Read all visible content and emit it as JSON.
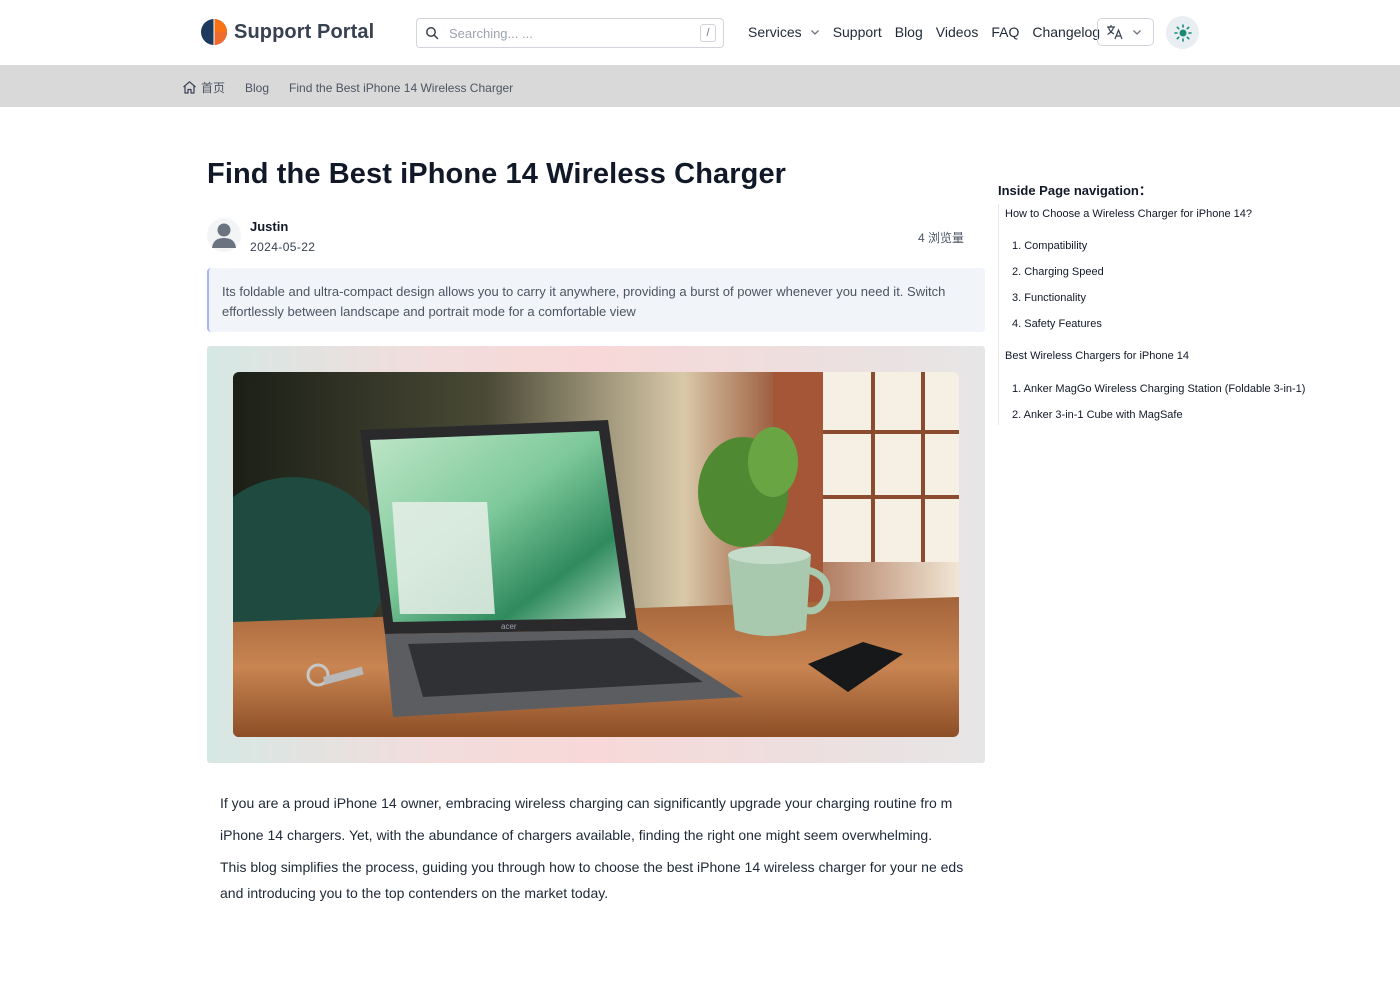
{
  "header": {
    "brand": "Support Portal",
    "search_placeholder": "Searching... ...",
    "search_shortcut": "/",
    "nav": [
      "Services",
      "Support",
      "Blog",
      "Videos",
      "FAQ",
      "Changelog"
    ]
  },
  "breadcrumb": [
    "首页",
    "Blog",
    "Find the Best iPhone 14 Wireless Charger"
  ],
  "article": {
    "title": "Find the Best iPhone 14 Wireless Charger",
    "author": "Justin",
    "date": "2024-05-22",
    "views": "4 浏览量",
    "summary": "Its foldable and ultra-compact design allows you to carry it anywhere, providing a burst of power whenever you need it. Switch effortlessly between landscape and portrait mode for a comfortable view",
    "laptop_brand": "acer",
    "paragraphs": [
      "If you are a proud iPhone 14 owner, embracing wireless charging can significantly upgrade your charging routine fro m",
      "iPhone 14 chargers. Yet, with the abundance of chargers available, finding the right one might seem overwhelming.",
      "This blog simplifies the process, guiding you through how to choose the best iPhone 14 wireless charger for your ne eds and introducing you to the top contenders on the market today."
    ]
  },
  "toc": {
    "title": "Inside Page navigation：",
    "sections": [
      {
        "heading": "How to Choose a Wireless Charger for iPhone 14?",
        "items": [
          "1. Compatibility",
          "2. Charging Speed",
          "3. Functionality",
          "4. Safety Features"
        ]
      },
      {
        "heading": "Best Wireless Chargers for iPhone 14",
        "items": [
          "1. Anker MagGo Wireless Charging Station (Foldable 3-in-1)",
          "2. Anker 3-in-1 Cube with MagSafe"
        ]
      }
    ]
  },
  "colors": {
    "accent": "#1a8a74",
    "logo_orange": "#f97316",
    "logo_navy": "#1e3a5f",
    "breadcrumb_bg": "#d9d9d9",
    "quote_bg": "#f1f4f8"
  }
}
